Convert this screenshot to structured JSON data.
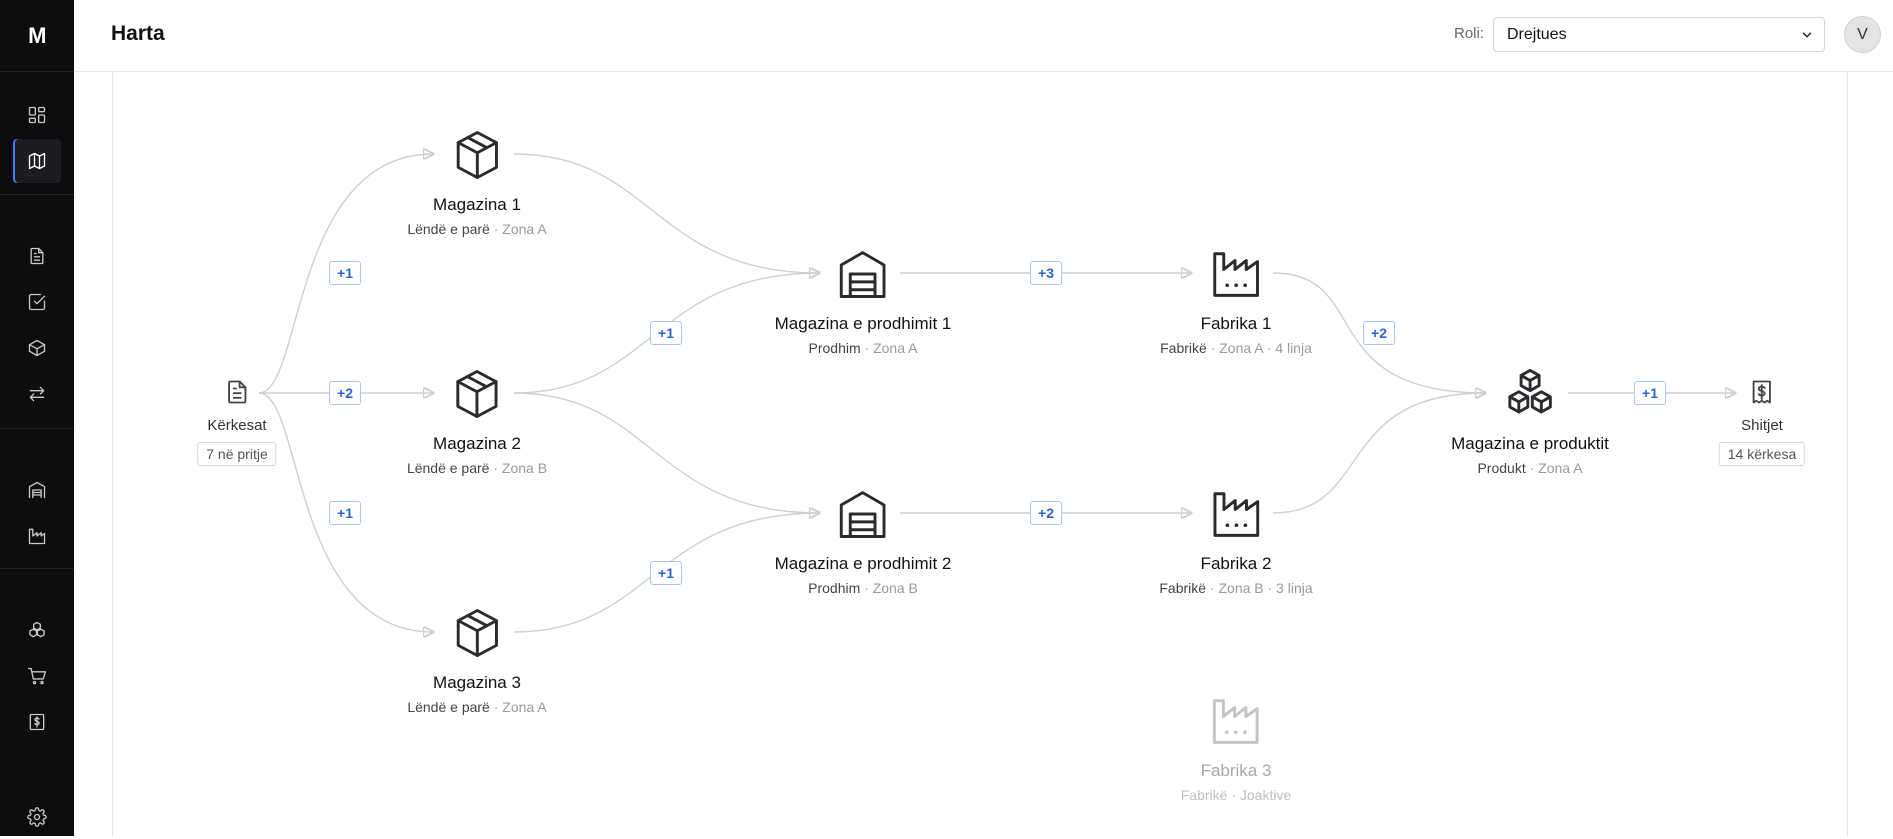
{
  "app": {
    "logo": "M"
  },
  "header": {
    "title": "Harta",
    "role_label": "Roli:",
    "role_value": "Drejtues",
    "avatar_initial": "V"
  },
  "sidebar": {
    "items": [
      {
        "name": "dashboard",
        "icon": "dashboard-icon"
      },
      {
        "name": "map",
        "icon": "map-icon",
        "active": true
      },
      {
        "name": "requests",
        "icon": "document-icon"
      },
      {
        "name": "tasks",
        "icon": "checkbox-icon"
      },
      {
        "name": "products",
        "icon": "box-icon"
      },
      {
        "name": "transfers",
        "icon": "arrows-icon"
      },
      {
        "name": "warehouses",
        "icon": "warehouse-icon"
      },
      {
        "name": "factories",
        "icon": "factory-icon"
      },
      {
        "name": "inventory",
        "icon": "boxes-icon"
      },
      {
        "name": "orders",
        "icon": "cart-icon"
      },
      {
        "name": "sales",
        "icon": "receipt-icon"
      },
      {
        "name": "settings",
        "icon": "gear-icon"
      }
    ]
  },
  "map": {
    "source": {
      "label": "Kërkesat",
      "pill": "7 në pritje"
    },
    "sink": {
      "label": "Shitjet",
      "pill": "14 kërkesa"
    },
    "nodes": [
      {
        "id": "m1",
        "title": "Magazina 1",
        "type": "Lëndë e parë",
        "meta": " · Zona A"
      },
      {
        "id": "m2",
        "title": "Magazina 2",
        "type": "Lëndë e parë",
        "meta": " · Zona B"
      },
      {
        "id": "m3",
        "title": "Magazina 3",
        "type": "Lëndë e parë",
        "meta": " · Zona A"
      },
      {
        "id": "mp1",
        "title": "Magazina e prodhimit 1",
        "type": "Prodhim",
        "meta": " · Zona A"
      },
      {
        "id": "mp2",
        "title": "Magazina e prodhimit 2",
        "type": "Prodhim",
        "meta": " · Zona B"
      },
      {
        "id": "f1",
        "title": "Fabrika 1",
        "type": "Fabrikë",
        "meta": " · Zona A · 4 linja"
      },
      {
        "id": "f2",
        "title": "Fabrika 2",
        "type": "Fabrikë",
        "meta": " · Zona B · 3 linja"
      },
      {
        "id": "f3",
        "title": "Fabrika 3",
        "type": "Fabrikë",
        "meta": " · Joaktive",
        "inactive": true
      },
      {
        "id": "mpr",
        "title": "Magazina e produktit",
        "type": "Produkt",
        "meta": " · Zona A"
      }
    ],
    "badges": {
      "src_m1": "+1",
      "src_m2": "+2",
      "src_m3": "+1",
      "m2_mp1": "+1",
      "m3_mp2": "+1",
      "mp1_f1": "+3",
      "mp2_f2": "+2",
      "f1_mpr": "+2",
      "mpr_sink": "+1"
    }
  }
}
